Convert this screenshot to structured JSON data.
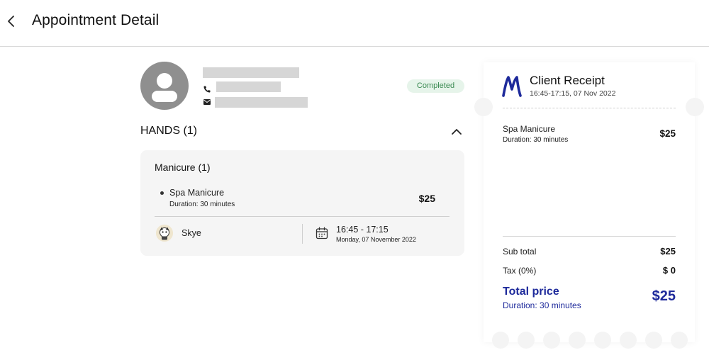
{
  "header": {
    "title": "Appointment Detail",
    "back_icon": "chevron-left-icon"
  },
  "client": {
    "avatar_icon": "user-avatar-icon",
    "phone_icon": "phone-icon",
    "email_icon": "mail-icon",
    "status": "Completed"
  },
  "group": {
    "title": "HANDS (1)",
    "toggle_icon": "chevron-up-icon"
  },
  "service_card": {
    "category": "Manicure (1)",
    "service_name": "Spa Manicure",
    "duration": "Duration: 30 minutes",
    "price": "$25",
    "staff_name": "Skye",
    "time_range": "16:45 - 17:15",
    "date": "Monday, 07 November 2022",
    "calendar_icon": "calendar-icon"
  },
  "receipt": {
    "title": "Client Receipt",
    "datetime": "16:45-17:15, 07 Nov 2022",
    "item_name": "Spa Manicure",
    "item_duration": "Duration: 30 minutes",
    "item_price": "$25",
    "subtotal_label": "Sub total",
    "subtotal_value": "$25",
    "tax_label": "Tax (0%)",
    "tax_value": "$ 0",
    "total_label": "Total price",
    "total_duration": "Duration: 30 minutes",
    "total_value": "$25",
    "accent_color": "#1e2a9b"
  },
  "colors": {
    "status_bg": "#e6f4ea",
    "status_text": "#3b8a52",
    "card_bg": "#f5f5f5"
  }
}
